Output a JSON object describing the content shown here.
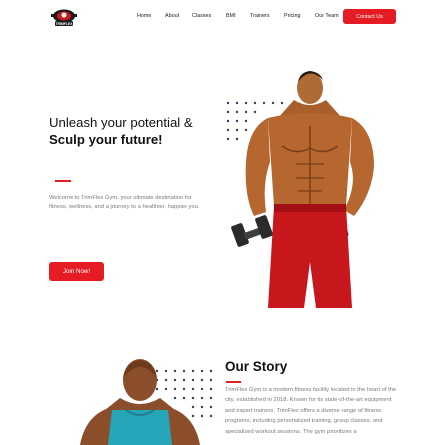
{
  "brand": {
    "logo_text": "TRIMFLEX"
  },
  "nav": {
    "items": [
      "Home",
      "About",
      "Classes",
      "BMI",
      "Trainers",
      "Pricing",
      "Our Team"
    ],
    "contact_label": "Contact Us"
  },
  "hero": {
    "title_line1": "Unleash your potential &",
    "title_line2": "Sculp your future!",
    "description": "Welcome to TrimFlex Gym, your ultimate destination for fitness, wellness, and a journey to a healthier, happier you.",
    "cta_label": "Join Now!"
  },
  "story": {
    "title": "Our Story",
    "text": "TrimFlex Gym is a modern fitness facility located in the heart of the city, established in 2018. Known for its state-of-the-art equipment and expert trainers, TrimFlex offers a diverse range of fitness programs, including personalized training, group classes, and specialized workout sessions. The gym prioritizes a"
  },
  "colors": {
    "accent": "#e51c23",
    "text_muted": "#7a7a86",
    "skin": "#b5672f",
    "shorts": "#c8161d"
  }
}
